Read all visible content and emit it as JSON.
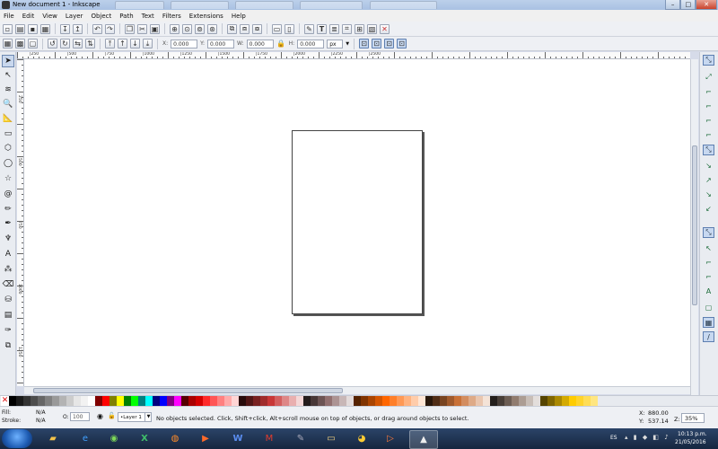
{
  "window": {
    "title": "New document 1 - Inkscape",
    "controls": [
      "–",
      "□",
      "✕"
    ]
  },
  "menu": [
    "File",
    "Edit",
    "View",
    "Layer",
    "Object",
    "Path",
    "Text",
    "Filters",
    "Extensions",
    "Help"
  ],
  "controls_bar": {
    "x_label": "X:",
    "x_value": "0.000",
    "y_label": "Y:",
    "y_value": "0.000",
    "w_label": "W:",
    "w_value": "0.000",
    "h_label": "H:",
    "h_value": "0.000",
    "unit": "px"
  },
  "ruler": {
    "top_numbers": [
      "|250",
      "|500",
      "|750",
      "|1000",
      "|1250",
      "|1500",
      "|1750",
      "|2000",
      "|2250",
      "|2500"
    ],
    "left_numbers": [
      "250",
      "500",
      "750",
      "1000",
      "1250"
    ]
  },
  "palette": {
    "none_symbol": "✕",
    "colors": [
      "#000000",
      "#1a1a1a",
      "#333333",
      "#4d4d4d",
      "#666666",
      "#808080",
      "#999999",
      "#b3b3b3",
      "#cccccc",
      "#e6e6e6",
      "#f2f2f2",
      "#ffffff",
      "#800000",
      "#ff0000",
      "#808000",
      "#ffff00",
      "#008000",
      "#00ff00",
      "#008080",
      "#00ffff",
      "#000080",
      "#0000ff",
      "#800080",
      "#ff00ff",
      "#550000",
      "#aa0000",
      "#d40000",
      "#ff2a2a",
      "#ff5555",
      "#ff8080",
      "#ffaaaa",
      "#ffd5d5",
      "#280b0b",
      "#501616",
      "#782121",
      "#a02c2c",
      "#c83737",
      "#d35f5f",
      "#de8787",
      "#e9afaf",
      "#f4d7d7",
      "#241c1c",
      "#483737",
      "#6c5353",
      "#916f6f",
      "#ac9393",
      "#c8b7b7",
      "#e3dbdb",
      "#552200",
      "#803300",
      "#aa4400",
      "#d45500",
      "#ff6600",
      "#ff7f2a",
      "#ff9955",
      "#ffb380",
      "#ffccaa",
      "#ffe6d5",
      "#28170b",
      "#502d16",
      "#784421",
      "#a05a2c",
      "#c87137",
      "#d38d5f",
      "#deaa87",
      "#e9c6af",
      "#f4e3d7",
      "#241f1c",
      "#483e37",
      "#6c5d53",
      "#917c6f",
      "#ac9d93",
      "#c8beb7",
      "#e3dedb",
      "#554400",
      "#806600",
      "#aa8800",
      "#d4aa00",
      "#ffcc00",
      "#ffd42a",
      "#ffdd55",
      "#ffe680"
    ]
  },
  "status": {
    "fill_label": "Fill:",
    "fill_value": "N/A",
    "stroke_label": "Stroke:",
    "stroke_value": "N/A",
    "opacity_label": "O:",
    "opacity_value": "100",
    "layer": "•Layer 1",
    "message": "No objects selected. Click, Shift+click, Alt+scroll mouse on top of objects, or drag around objects to select.",
    "x_label": "X:",
    "x_value": "880.00",
    "y_label": "Y:",
    "y_value": "537.14",
    "zoom_label": "Z:",
    "zoom_value": "35%"
  },
  "taskbar": {
    "language": "ES",
    "time": "10:13 p.m.",
    "date": "21/05/2016"
  }
}
